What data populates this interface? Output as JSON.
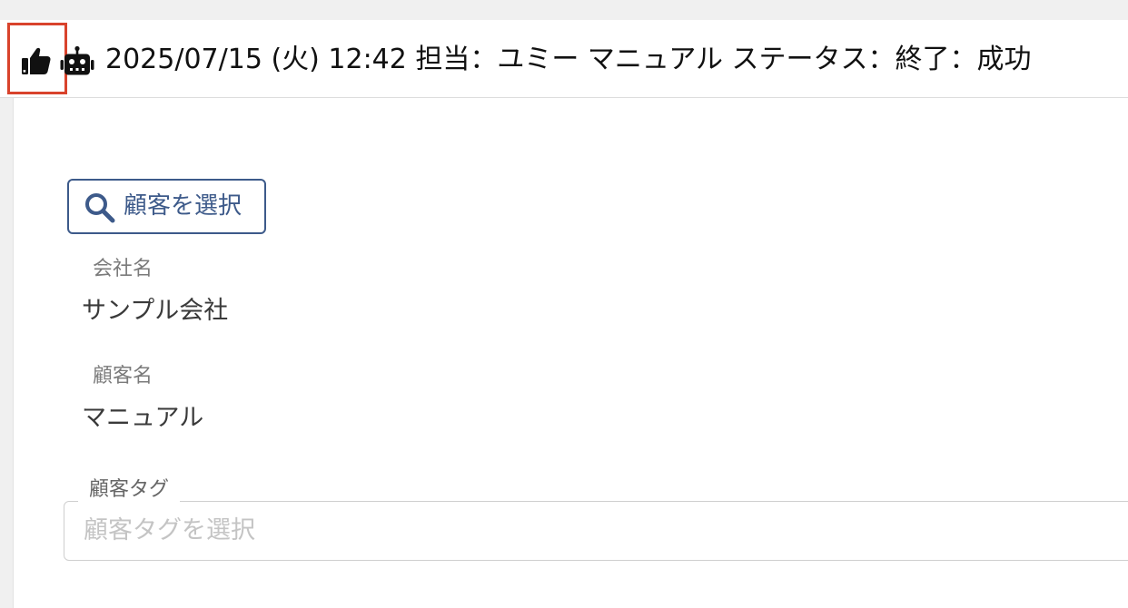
{
  "header": {
    "thumb_icon": "thumbs-up-icon",
    "robot_icon": "robot-icon",
    "text": "2025/07/15 (火) 12:42 担当：ユミー マニュアル ステータス：終了：成功",
    "highlight_color": "#d9432c"
  },
  "customer_select": {
    "icon": "search-icon",
    "label": "顧客を選択",
    "accent_color": "#3d5a8a"
  },
  "fields": {
    "company_label": "会社名",
    "company_value": "サンプル会社",
    "customer_label": "顧客名",
    "customer_value": "マニュアル"
  },
  "tags": {
    "label": "顧客タグ",
    "placeholder": "顧客タグを選択"
  }
}
